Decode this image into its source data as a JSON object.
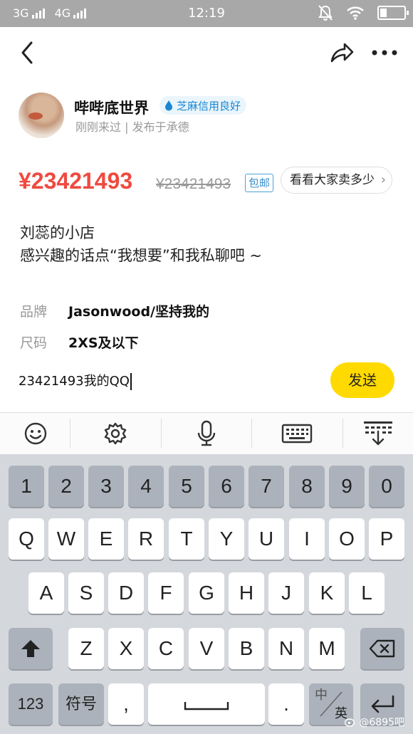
{
  "status_bar": {
    "signal1": "3G",
    "signal2": "4G",
    "time": "12:19"
  },
  "seller": {
    "name": "哔哔底世界",
    "credit_badge": "芝麻信用良好",
    "meta": "刚刚来过 | 发布于承德"
  },
  "price": {
    "current": "¥23421493",
    "original": "¥23421493",
    "free_shipping": "包邮",
    "price_check_label": "看看大家卖多少"
  },
  "description": {
    "line1": "刘蕊的小店",
    "line2": "感兴趣的话点“我想要”和我私聊吧 ~"
  },
  "attributes": [
    {
      "key": "品牌",
      "value": "Jasonwood/坚持我的"
    },
    {
      "key": "尺码",
      "value": "2XS及以下"
    }
  ],
  "message": {
    "value": "23421493我的QQ",
    "send_label": "发送"
  },
  "keyboard": {
    "row_digits": [
      "1",
      "2",
      "3",
      "4",
      "5",
      "6",
      "7",
      "8",
      "9",
      "0"
    ],
    "row1": [
      "Q",
      "W",
      "E",
      "R",
      "T",
      "Y",
      "U",
      "I",
      "O",
      "P"
    ],
    "row2": [
      "A",
      "S",
      "D",
      "F",
      "G",
      "H",
      "J",
      "K",
      "L"
    ],
    "row3": [
      "Z",
      "X",
      "C",
      "V",
      "B",
      "N",
      "M"
    ],
    "num_label": "123",
    "symbol_label": "符号",
    "comma": ",",
    "period": ".",
    "lang_top": "中",
    "lang_bottom": "英"
  },
  "watermark": "@6895吧",
  "colors": {
    "price_red": "#ef4a40",
    "send_yellow": "#ffda00",
    "credit_blue": "#1a86d1"
  }
}
